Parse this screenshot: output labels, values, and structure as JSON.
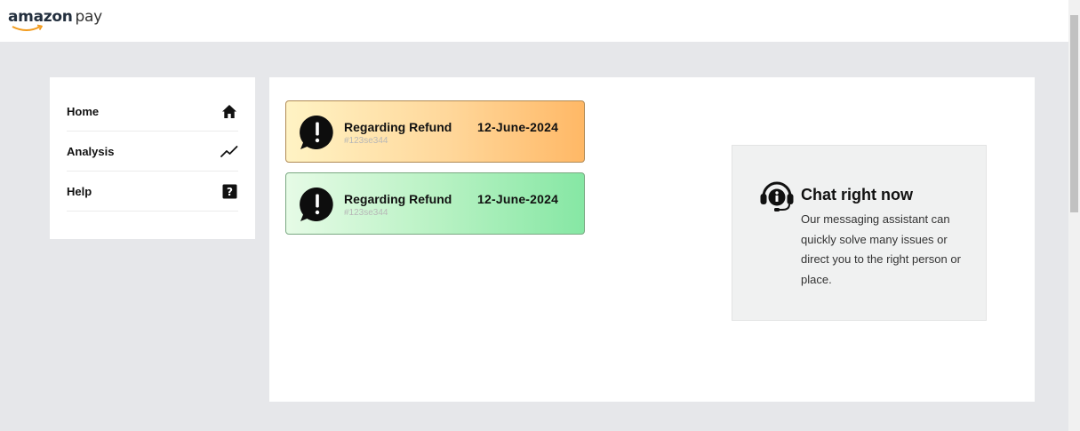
{
  "header": {
    "logo_word1": "amazon",
    "logo_word2": "pay"
  },
  "sidebar": {
    "items": [
      {
        "label": "Home",
        "icon": "home-icon"
      },
      {
        "label": "Analysis",
        "icon": "trending-icon"
      },
      {
        "label": "Help",
        "icon": "help-icon"
      }
    ]
  },
  "main": {
    "tickets": [
      {
        "title": "Regarding Refund",
        "id": "#123se344",
        "date": "12-June-2024",
        "color": "#ffb866"
      },
      {
        "title": "Regarding Refund",
        "id": "#123se344",
        "date": "12-June-2024",
        "color": "#86e7a4"
      }
    ],
    "chat": {
      "title": "Chat right now",
      "description": "Our messaging assistant can quickly solve many issues or direct you to the right person or place.",
      "icon": "headset-icon"
    }
  },
  "colors": {
    "background": "#e6e7ea",
    "panel": "#ffffff",
    "chat_box": "#f0f1f1"
  }
}
